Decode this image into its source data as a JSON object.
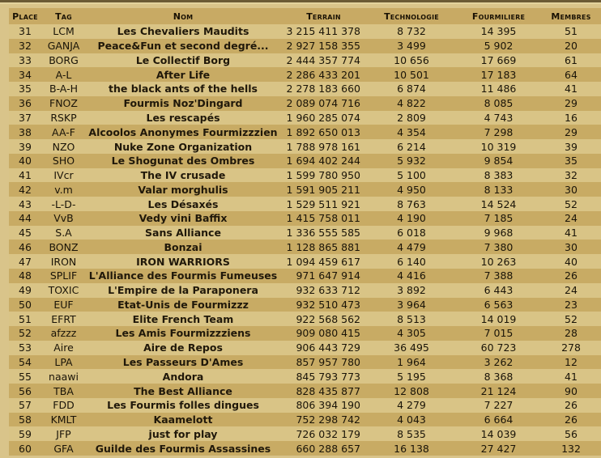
{
  "table": {
    "headers": {
      "place": "Place",
      "tag": "Tag",
      "nom": "Nom",
      "terrain": "Terrain",
      "technologie": "Technologie",
      "fourmiliere": "Fourmiliere",
      "membres": "Membres"
    },
    "rows": [
      {
        "place": "31",
        "tag": "LCM",
        "nom": "Les Chevaliers Maudits",
        "terrain": "3 215 411 378",
        "technologie": "8 732",
        "fourmiliere": "14 395",
        "membres": "51"
      },
      {
        "place": "32",
        "tag": "GANJA",
        "nom": "Peace&Fun et second degré...",
        "terrain": "2 927 158 355",
        "technologie": "3 499",
        "fourmiliere": "5 902",
        "membres": "20"
      },
      {
        "place": "33",
        "tag": "BORG",
        "nom": "Le Collectif Borg",
        "terrain": "2 444 357 774",
        "technologie": "10 656",
        "fourmiliere": "17 669",
        "membres": "61"
      },
      {
        "place": "34",
        "tag": "A-L",
        "nom": "After Life",
        "terrain": "2 286 433 201",
        "technologie": "10 501",
        "fourmiliere": "17 183",
        "membres": "64"
      },
      {
        "place": "35",
        "tag": "B-A-H",
        "nom": "the black ants of the hells",
        "terrain": "2 278 183 660",
        "technologie": "6 874",
        "fourmiliere": "11 486",
        "membres": "41"
      },
      {
        "place": "36",
        "tag": "FNOZ",
        "nom": "Fourmis Noz'Dingard",
        "terrain": "2 089 074 716",
        "technologie": "4 822",
        "fourmiliere": "8 085",
        "membres": "29"
      },
      {
        "place": "37",
        "tag": "RSKP",
        "nom": "Les rescapés",
        "terrain": "1 960 285 074",
        "technologie": "2 809",
        "fourmiliere": "4 743",
        "membres": "16"
      },
      {
        "place": "38",
        "tag": "AA-F",
        "nom": "Alcoolos Anonymes Fourmizzzien",
        "terrain": "1 892 650 013",
        "technologie": "4 354",
        "fourmiliere": "7 298",
        "membres": "29"
      },
      {
        "place": "39",
        "tag": "NZO",
        "nom": "Nuke Zone Organization",
        "terrain": "1 788 978 161",
        "technologie": "6 214",
        "fourmiliere": "10 319",
        "membres": "39"
      },
      {
        "place": "40",
        "tag": "SHO",
        "nom": "Le Shogunat des Ombres",
        "terrain": "1 694 402 244",
        "technologie": "5 932",
        "fourmiliere": "9 854",
        "membres": "35"
      },
      {
        "place": "41",
        "tag": "IVcr",
        "nom": "The IV crusade",
        "terrain": "1 599 780 950",
        "technologie": "5 100",
        "fourmiliere": "8 383",
        "membres": "32"
      },
      {
        "place": "42",
        "tag": "v.m",
        "nom": "Valar morghulis",
        "terrain": "1 591 905 211",
        "technologie": "4 950",
        "fourmiliere": "8 133",
        "membres": "30"
      },
      {
        "place": "43",
        "tag": "-L-D-",
        "nom": "Les Désaxés",
        "terrain": "1 529 511 921",
        "technologie": "8 763",
        "fourmiliere": "14 524",
        "membres": "52"
      },
      {
        "place": "44",
        "tag": "VvB",
        "nom": "Vedy vini Baffix",
        "terrain": "1 415 758 011",
        "technologie": "4 190",
        "fourmiliere": "7 185",
        "membres": "24"
      },
      {
        "place": "45",
        "tag": "S.A",
        "nom": "Sans Alliance",
        "terrain": "1 336 555 585",
        "technologie": "6 018",
        "fourmiliere": "9 968",
        "membres": "41"
      },
      {
        "place": "46",
        "tag": "BONZ",
        "nom": "Bonzai",
        "terrain": "1 128 865 881",
        "technologie": "4 479",
        "fourmiliere": "7 380",
        "membres": "30"
      },
      {
        "place": "47",
        "tag": "IRON",
        "nom": "IRON WARRIORS",
        "terrain": "1 094 459 617",
        "technologie": "6 140",
        "fourmiliere": "10 263",
        "membres": "40"
      },
      {
        "place": "48",
        "tag": "SPLIF",
        "nom": "L'Alliance des Fourmis Fumeuses",
        "terrain": "971 647 914",
        "technologie": "4 416",
        "fourmiliere": "7 388",
        "membres": "26"
      },
      {
        "place": "49",
        "tag": "TOXIC",
        "nom": "L'Empire de la Paraponera",
        "terrain": "932 633 712",
        "technologie": "3 892",
        "fourmiliere": "6 443",
        "membres": "24"
      },
      {
        "place": "50",
        "tag": "EUF",
        "nom": "Etat-Unis de Fourmizzz",
        "terrain": "932 510 473",
        "technologie": "3 964",
        "fourmiliere": "6 563",
        "membres": "23"
      },
      {
        "place": "51",
        "tag": "EFRT",
        "nom": "Elite French Team",
        "terrain": "922 568 562",
        "technologie": "8 513",
        "fourmiliere": "14 019",
        "membres": "52"
      },
      {
        "place": "52",
        "tag": "afzzz",
        "nom": "Les Amis Fourmizzziens",
        "terrain": "909 080 415",
        "technologie": "4 305",
        "fourmiliere": "7 015",
        "membres": "28"
      },
      {
        "place": "53",
        "tag": "Aire",
        "nom": "Aire de Repos",
        "terrain": "906 443 729",
        "technologie": "36 495",
        "fourmiliere": "60 723",
        "membres": "278"
      },
      {
        "place": "54",
        "tag": "LPA",
        "nom": "Les Passeurs D'Ames",
        "terrain": "857 957 780",
        "technologie": "1 964",
        "fourmiliere": "3 262",
        "membres": "12"
      },
      {
        "place": "55",
        "tag": "naawi",
        "nom": "Andora",
        "terrain": "845 793 773",
        "technologie": "5 195",
        "fourmiliere": "8 368",
        "membres": "41"
      },
      {
        "place": "56",
        "tag": "TBA",
        "nom": "The Best Alliance",
        "terrain": "828 435 877",
        "technologie": "12 808",
        "fourmiliere": "21 124",
        "membres": "90"
      },
      {
        "place": "57",
        "tag": "FDD",
        "nom": "Les Fourmis folles dingues",
        "terrain": "806 394 190",
        "technologie": "4 279",
        "fourmiliere": "7 227",
        "membres": "26"
      },
      {
        "place": "58",
        "tag": "KMLT",
        "nom": "Kaamelott",
        "terrain": "752 298 742",
        "technologie": "4 043",
        "fourmiliere": "6 664",
        "membres": "26"
      },
      {
        "place": "59",
        "tag": "JFP",
        "nom": "just for play",
        "terrain": "726 032 179",
        "technologie": "8 535",
        "fourmiliere": "14 039",
        "membres": "56"
      },
      {
        "place": "60",
        "tag": "GFA",
        "nom": "Guilde des Fourmis Assassines",
        "terrain": "660 288 657",
        "technologie": "16 138",
        "fourmiliere": "27 427",
        "membres": "132"
      }
    ]
  },
  "colors": {
    "page_background": "#d9c48a",
    "header_background": "#c8aa64",
    "row_light": "#d9c486",
    "row_dark": "#c8ab64",
    "top_rule": "#6b5a34"
  }
}
